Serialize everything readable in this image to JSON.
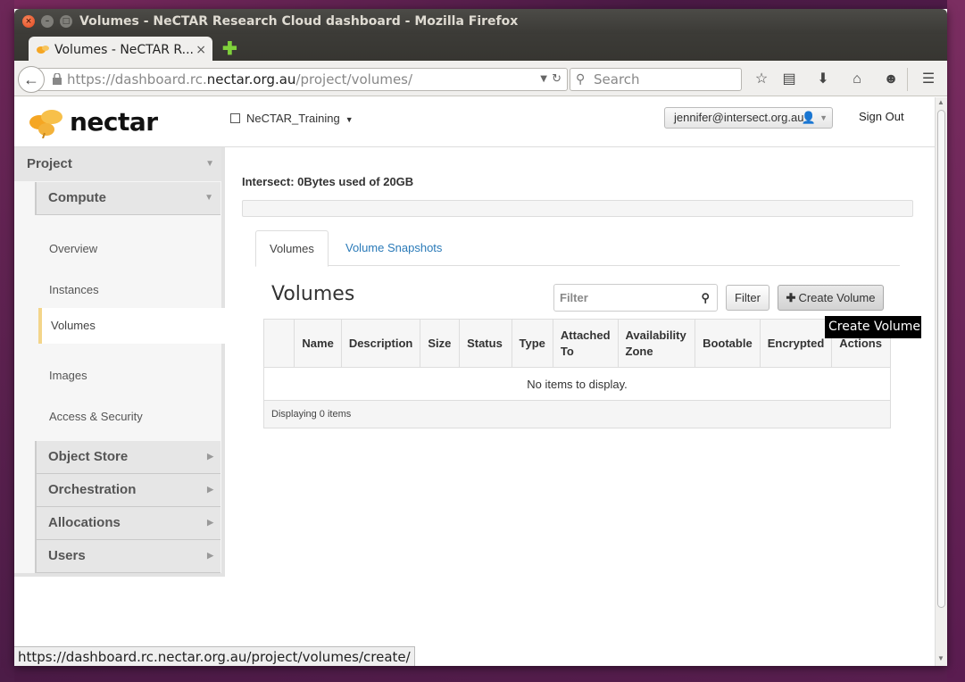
{
  "window": {
    "title": "Volumes - NeCTAR Research Cloud dashboard - Mozilla Firefox",
    "close_glyph": "×",
    "min_glyph": "–",
    "max_glyph": "□"
  },
  "browser": {
    "tab_title": "Volumes - NeCTAR R...",
    "tab_close": "×",
    "new_tab": "✚",
    "url_prefix": "https://dashboard.rc.",
    "url_host": "nectar.org.au",
    "url_path": "/project/volumes/",
    "search_placeholder": "Search",
    "status_url": "https://dashboard.rc.nectar.org.au/project/volumes/create/"
  },
  "header": {
    "logo_text": "nectar",
    "project_name": "NeCTAR_Training",
    "user_email": "jennifer@intersect.org.au",
    "sign_out": "Sign Out"
  },
  "sidebar": {
    "project": "Project",
    "compute": "Compute",
    "compute_items": [
      "Overview",
      "Instances",
      "Volumes",
      "Images",
      "Access & Security"
    ],
    "active_item": "Volumes",
    "groups": [
      "Object Store",
      "Orchestration",
      "Allocations",
      "Users"
    ]
  },
  "main": {
    "quota_text": "Intersect: 0Bytes used of 20GB",
    "tabs": [
      "Volumes",
      "Volume Snapshots"
    ],
    "heading": "Volumes",
    "filter_placeholder": "Filter",
    "filter_button": "Filter",
    "create_button": "Create Volume",
    "tooltip": "Create Volume",
    "table_columns": [
      "",
      "Name",
      "Description",
      "Size",
      "Status",
      "Type",
      "Attached To",
      "Availability Zone",
      "Bootable",
      "Encrypted",
      "Actions"
    ],
    "empty_text": "No items to display.",
    "footer_text": "Displaying 0 items"
  },
  "colors": {
    "link_blue": "#2a7ab8",
    "active_accent": "#f3d58a",
    "logo_orange": "#f5a623"
  }
}
